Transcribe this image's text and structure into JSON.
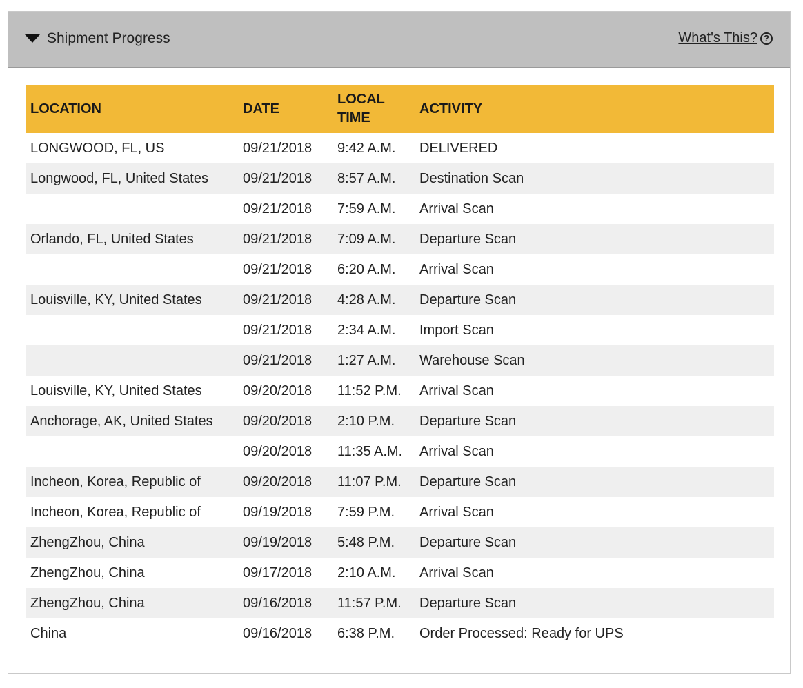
{
  "panel": {
    "title": "Shipment Progress",
    "help_link": "What's This?",
    "help_icon_glyph": "?",
    "header_color": "#bfbfbf",
    "table_header_color": "#f2b937"
  },
  "table": {
    "headers": {
      "location": "LOCATION",
      "date": "DATE",
      "local_time_line1": "LOCAL",
      "local_time_line2": "TIME",
      "activity": "ACTIVITY"
    },
    "rows": [
      {
        "location": "LONGWOOD,  FL,  US",
        "date": "09/21/2018",
        "time": "9:42 A.M.",
        "activity": "DELIVERED"
      },
      {
        "location": "Longwood,  FL,  United States",
        "date": "09/21/2018",
        "time": "8:57 A.M.",
        "activity": "Destination Scan"
      },
      {
        "location": "",
        "date": "09/21/2018",
        "time": "7:59 A.M.",
        "activity": "Arrival Scan"
      },
      {
        "location": "Orlando,  FL,  United States",
        "date": "09/21/2018",
        "time": "7:09 A.M.",
        "activity": "Departure Scan"
      },
      {
        "location": "",
        "date": "09/21/2018",
        "time": "6:20 A.M.",
        "activity": "Arrival Scan"
      },
      {
        "location": "Louisville,  KY,  United States",
        "date": "09/21/2018",
        "time": "4:28 A.M.",
        "activity": "Departure Scan"
      },
      {
        "location": "",
        "date": "09/21/2018",
        "time": "2:34 A.M.",
        "activity": "Import Scan"
      },
      {
        "location": "",
        "date": "09/21/2018",
        "time": "1:27 A.M.",
        "activity": "Warehouse Scan"
      },
      {
        "location": "Louisville,  KY,  United States",
        "date": "09/20/2018",
        "time": "11:52 P.M.",
        "activity": "Arrival Scan"
      },
      {
        "location": "Anchorage,  AK,  United States",
        "date": "09/20/2018",
        "time": "2:10 P.M.",
        "activity": "Departure Scan"
      },
      {
        "location": "",
        "date": "09/20/2018",
        "time": "11:35 A.M.",
        "activity": "Arrival Scan"
      },
      {
        "location": "Incheon,  Korea, Republic of",
        "date": "09/20/2018",
        "time": "11:07 P.M.",
        "activity": "Departure Scan"
      },
      {
        "location": "Incheon,  Korea, Republic of",
        "date": "09/19/2018",
        "time": "7:59 P.M.",
        "activity": "Arrival Scan"
      },
      {
        "location": "ZhengZhou,  China",
        "date": "09/19/2018",
        "time": "5:48 P.M.",
        "activity": "Departure Scan"
      },
      {
        "location": "ZhengZhou,  China",
        "date": "09/17/2018",
        "time": "2:10 A.M.",
        "activity": "Arrival Scan"
      },
      {
        "location": "ZhengZhou,  China",
        "date": "09/16/2018",
        "time": "11:57 P.M.",
        "activity": "Departure Scan"
      },
      {
        "location": "China",
        "date": "09/16/2018",
        "time": "6:38 P.M.",
        "activity": "Order Processed: Ready for UPS"
      }
    ]
  }
}
